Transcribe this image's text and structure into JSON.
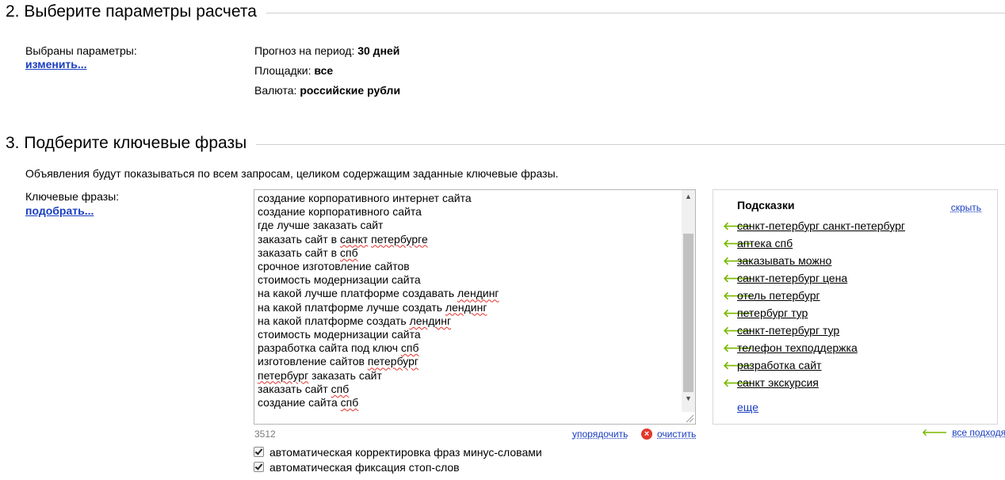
{
  "section2": {
    "title": "2. Выберите параметры расчета",
    "selected_label": "Выбраны параметры:",
    "change_link": "изменить...",
    "forecast_label": "Прогноз на период:",
    "forecast_value": "30 дней",
    "platforms_label": "Площадки:",
    "platforms_value": "все",
    "currency_label": "Валюта:",
    "currency_value": "российские рубли"
  },
  "section3": {
    "title": "3. Подберите ключевые фразы",
    "description": "Объявления будут показываться по всем запросам, целиком содержащим заданные ключевые фразы.",
    "phrases_label": "Ключевые фразы:",
    "pick_link": "подобрать...",
    "phrases": [
      [
        {
          "t": "создание корпоративного интернет сайта"
        }
      ],
      [
        {
          "t": "создание корпоративного сайта"
        }
      ],
      [
        {
          "t": "где лучше заказать сайт"
        }
      ],
      [
        {
          "t": "заказать сайт в "
        },
        {
          "t": "санкт",
          "sq": true
        },
        {
          "t": " "
        },
        {
          "t": "петербурге",
          "sq": true
        }
      ],
      [
        {
          "t": "заказать сайт в "
        },
        {
          "t": "спб",
          "sq": true
        }
      ],
      [
        {
          "t": "срочное изготовление сайтов"
        }
      ],
      [
        {
          "t": "стоимость модернизации сайта"
        }
      ],
      [
        {
          "t": "на какой лучше платформе создавать "
        },
        {
          "t": "лендинг",
          "sq": true
        }
      ],
      [
        {
          "t": "на какой платформе лучше создать "
        },
        {
          "t": "лендинг",
          "sq": true
        }
      ],
      [
        {
          "t": "на какой платформе создать "
        },
        {
          "t": "лендинг",
          "sq": true
        }
      ],
      [
        {
          "t": "стоимость модернизации сайта"
        }
      ],
      [
        {
          "t": "разработка сайта под ключ "
        },
        {
          "t": "спб",
          "sq": true
        }
      ],
      [
        {
          "t": "изготовление сайтов "
        },
        {
          "t": "петербург",
          "sq": true
        }
      ],
      [
        {
          "t": "петербург",
          "sq": true
        },
        {
          "t": " заказать сайт"
        }
      ],
      [
        {
          "t": "заказать сайт "
        },
        {
          "t": "спб",
          "sq": true
        }
      ],
      [
        {
          "t": "создание сайта "
        },
        {
          "t": "спб",
          "sq": true
        }
      ]
    ],
    "counter": "3512",
    "sort_link": "упорядочить",
    "clear_link": "очистить",
    "checkbox1": "автоматическая корректировка фраз минус-словами",
    "checkbox2": "автоматическая фиксация стоп-слов"
  },
  "hints": {
    "title": "Подсказки",
    "hide_link": "скрыть",
    "items": [
      "санкт-петербург санкт-петербург",
      "аптека спб",
      "заказывать можно",
      "санкт-петербург цена",
      "отель петербург",
      "петербург тур",
      "санкт-петербург тур",
      "телефон техподдержка",
      "разработка сайт",
      "санкт экскурсия"
    ],
    "more_link": "еще",
    "all_fit_link": "все подходят"
  },
  "icons": {
    "hint_arrow": "arrow-left-icon",
    "clear": "clear-x-icon",
    "accent_green": "#7ab800",
    "link_blue": "#1a3dc1",
    "clear_red": "#e0392c"
  }
}
